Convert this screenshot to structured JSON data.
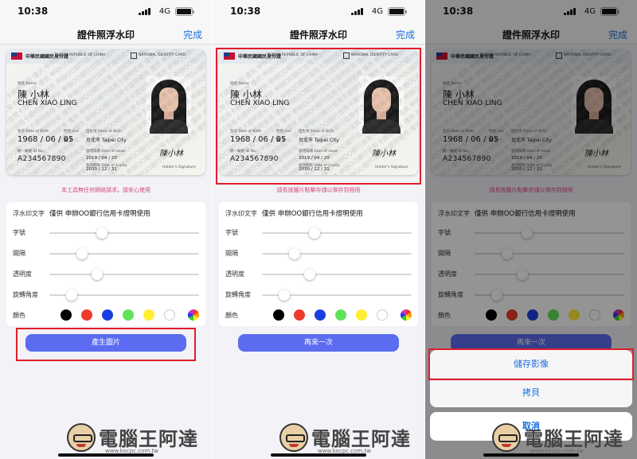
{
  "status_bar": {
    "time": "10:38",
    "network": "4G"
  },
  "nav": {
    "title": "證件照浮水印",
    "done": "完成"
  },
  "id_card": {
    "header_cn": "中華民國國民身分證",
    "header_en": "TAIWAN REPUBLIC OF CHINA",
    "header_en2": "NATIONAL IDENTITY CARD",
    "name_label": "姓名 Name",
    "name_cn": "陳 小林",
    "name_en": "CHEN XIAO LING",
    "dob_label": "生日 Date of Birth",
    "dob": "1968 / 06 / 05",
    "sex_label": "性別 Sex",
    "sex": "女 F",
    "place_label": "出生地 Place of Birth",
    "place": "台北市 Taipei City",
    "id_label": "統一編號 ID No.",
    "id_no": "A234567890",
    "issue_label": "發證日期 Date of Issue",
    "issue": "2019 / 04 / 20",
    "expiry_label": "有效期限 Date of Expiry",
    "expiry": "2030 / 12 / 31",
    "signature": "陳小林",
    "signature_label": "Holder's Signature",
    "watermark_line": "僅供 申辦OO銀行信用卡證明使用 僅供 申辦OO銀行信用卡證明使用 僅供 申辦OO銀行信用卡證明使用"
  },
  "notices": {
    "p1": "本工具無任何網絡請求，請安心使用",
    "p2": "請長按圖片點擊存儲以保存到相冊",
    "p3": "請長按圖片點擊存儲以保存到相冊"
  },
  "settings": {
    "watermark_label": "浮水印文字",
    "watermark_text": "僅供 申辦OO銀行信用卡證明使用",
    "font_size_label": "字號",
    "spacing_label": "間隔",
    "opacity_label": "透明度",
    "rotation_label": "旋轉角度",
    "color_label": "顏色",
    "values": {
      "font_size": 0.35,
      "spacing": 0.22,
      "opacity": 0.32,
      "rotation": 0.15
    }
  },
  "colors": [
    "#000000",
    "#ee3b2b",
    "#1a3fe0",
    "#5fe25a",
    "#ffee33",
    "#ffffff"
  ],
  "buttons": {
    "generate": "產生圖片",
    "again": "再來一次"
  },
  "action_sheet": {
    "save_image": "儲存影像",
    "copy": "拷貝",
    "cancel": "取消"
  },
  "branding": {
    "name": "電腦王阿達",
    "url": "www.kocpc.com.tw"
  }
}
